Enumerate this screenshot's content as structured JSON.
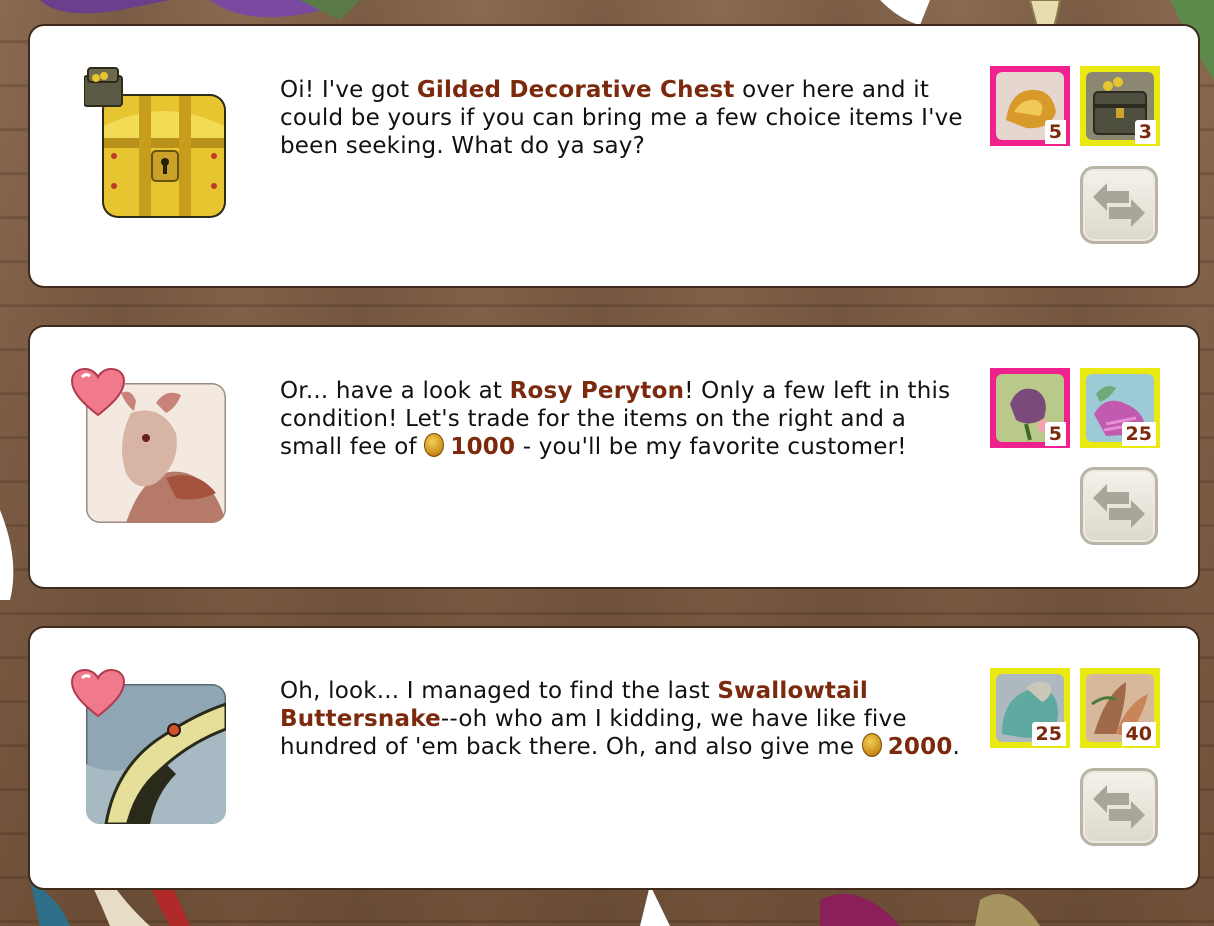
{
  "offers": [
    {
      "portrait_icon": "treasure-chest-icon",
      "has_heart": false,
      "text_parts": {
        "before": "Oi! I've got ",
        "highlight": "Gilded Decorative Chest",
        "after": " over here and it could be yours if you can bring me a few choice items I've been seeking. What do ya say?"
      },
      "items": [
        {
          "icon": "gold-ore-icon",
          "qty": "5",
          "rarity_color": "#f0208f"
        },
        {
          "icon": "chest-icon",
          "qty": "3",
          "rarity_color": "#eaea12"
        }
      ],
      "trade_button_icon": "swap-arrows-icon"
    },
    {
      "portrait_icon": "rosy-peryton-icon",
      "has_heart": true,
      "text_parts": {
        "before": "Or... have a look at ",
        "highlight": "Rosy Peryton",
        "middle": "! Only a few left in this condition! Let's trade for the items on the right and a small fee of ",
        "fee": "1000",
        "after": " - you'll be my favorite customer!"
      },
      "items": [
        {
          "icon": "rose-icon",
          "qty": "5",
          "rarity_color": "#f0208f"
        },
        {
          "icon": "pink-fabric-icon",
          "qty": "25",
          "rarity_color": "#eaea12"
        }
      ],
      "trade_button_icon": "swap-arrows-icon"
    },
    {
      "portrait_icon": "swallowtail-buttersnake-icon",
      "has_heart": true,
      "text_parts": {
        "before": "Oh, look... I managed to find the last ",
        "highlight": "Swallowtail Buttersnake",
        "middle": "--oh who am I kidding, we have like five hundred of 'em back there. Oh, and also give me ",
        "fee": "2000",
        "after": "."
      },
      "items": [
        {
          "icon": "shell-icon",
          "qty": "25",
          "rarity_color": "#eaea12"
        },
        {
          "icon": "feather-icon",
          "qty": "40",
          "rarity_color": "#eaea12"
        }
      ],
      "trade_button_icon": "swap-arrows-icon"
    }
  ]
}
